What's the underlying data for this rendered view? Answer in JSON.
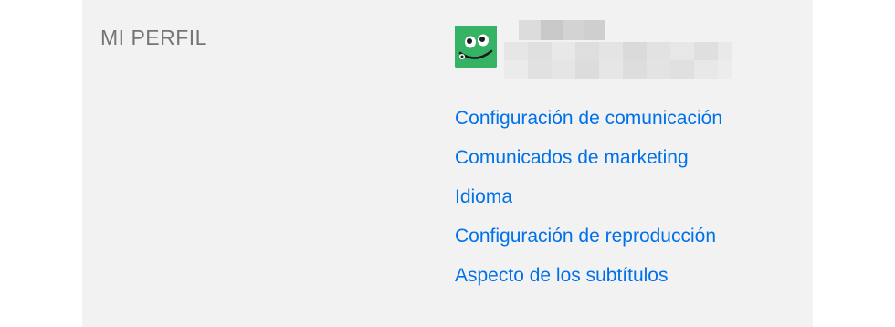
{
  "profile": {
    "section_title": "MI PERFIL",
    "avatar_icon": "green-smiley-avatar-icon",
    "avatar_color": "#36b265",
    "name_redacted": true,
    "email_redacted": true
  },
  "links": [
    {
      "label": "Configuración de comunicación"
    },
    {
      "label": "Comunicados de marketing"
    },
    {
      "label": "Idioma"
    },
    {
      "label": "Configuración de reproducción"
    },
    {
      "label": "Aspecto de los subtítulos"
    }
  ],
  "colors": {
    "link": "#0071eb",
    "panel_bg": "#f2f2f2",
    "title": "#757575"
  }
}
